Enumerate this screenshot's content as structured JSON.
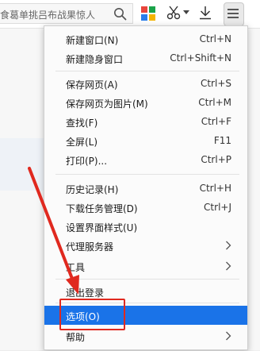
{
  "toolbar": {
    "search_text": "食葛单挑吕布战果惊人",
    "icons": [
      "search-icon",
      "apps-icon",
      "scissors-icon",
      "download-icon",
      "menu-icon"
    ]
  },
  "menu": {
    "items": [
      {
        "label": "新建窗口(N)",
        "shortcut": "Ctrl+N"
      },
      {
        "label": "新建隐身窗口",
        "shortcut": "Ctrl+Shift+N"
      },
      {
        "label": "保存网页(A)",
        "shortcut": "Ctrl+S"
      },
      {
        "label": "保存网页为图片(M)",
        "shortcut": "Ctrl+M"
      },
      {
        "label": "查找(F)",
        "shortcut": "Ctrl+F"
      },
      {
        "label": "全屏(L)",
        "shortcut": "F11"
      },
      {
        "label": "打印(P)...",
        "shortcut": "Ctrl+P"
      },
      {
        "label": "历史记录(H)",
        "shortcut": "Ctrl+H"
      },
      {
        "label": "下载任务管理(D)",
        "shortcut": "Ctrl+J"
      },
      {
        "label": "设置界面样式(U)",
        "shortcut": ""
      },
      {
        "label": "代理服务器",
        "shortcut": ""
      },
      {
        "label": "工具",
        "shortcut": ""
      },
      {
        "label": "退出登录",
        "shortcut": ""
      },
      {
        "label": "选项(O)",
        "shortcut": ""
      },
      {
        "label": "帮助",
        "shortcut": ""
      }
    ]
  },
  "colors": {
    "highlight": "#1a73e8",
    "annotation": "#e0291f"
  }
}
